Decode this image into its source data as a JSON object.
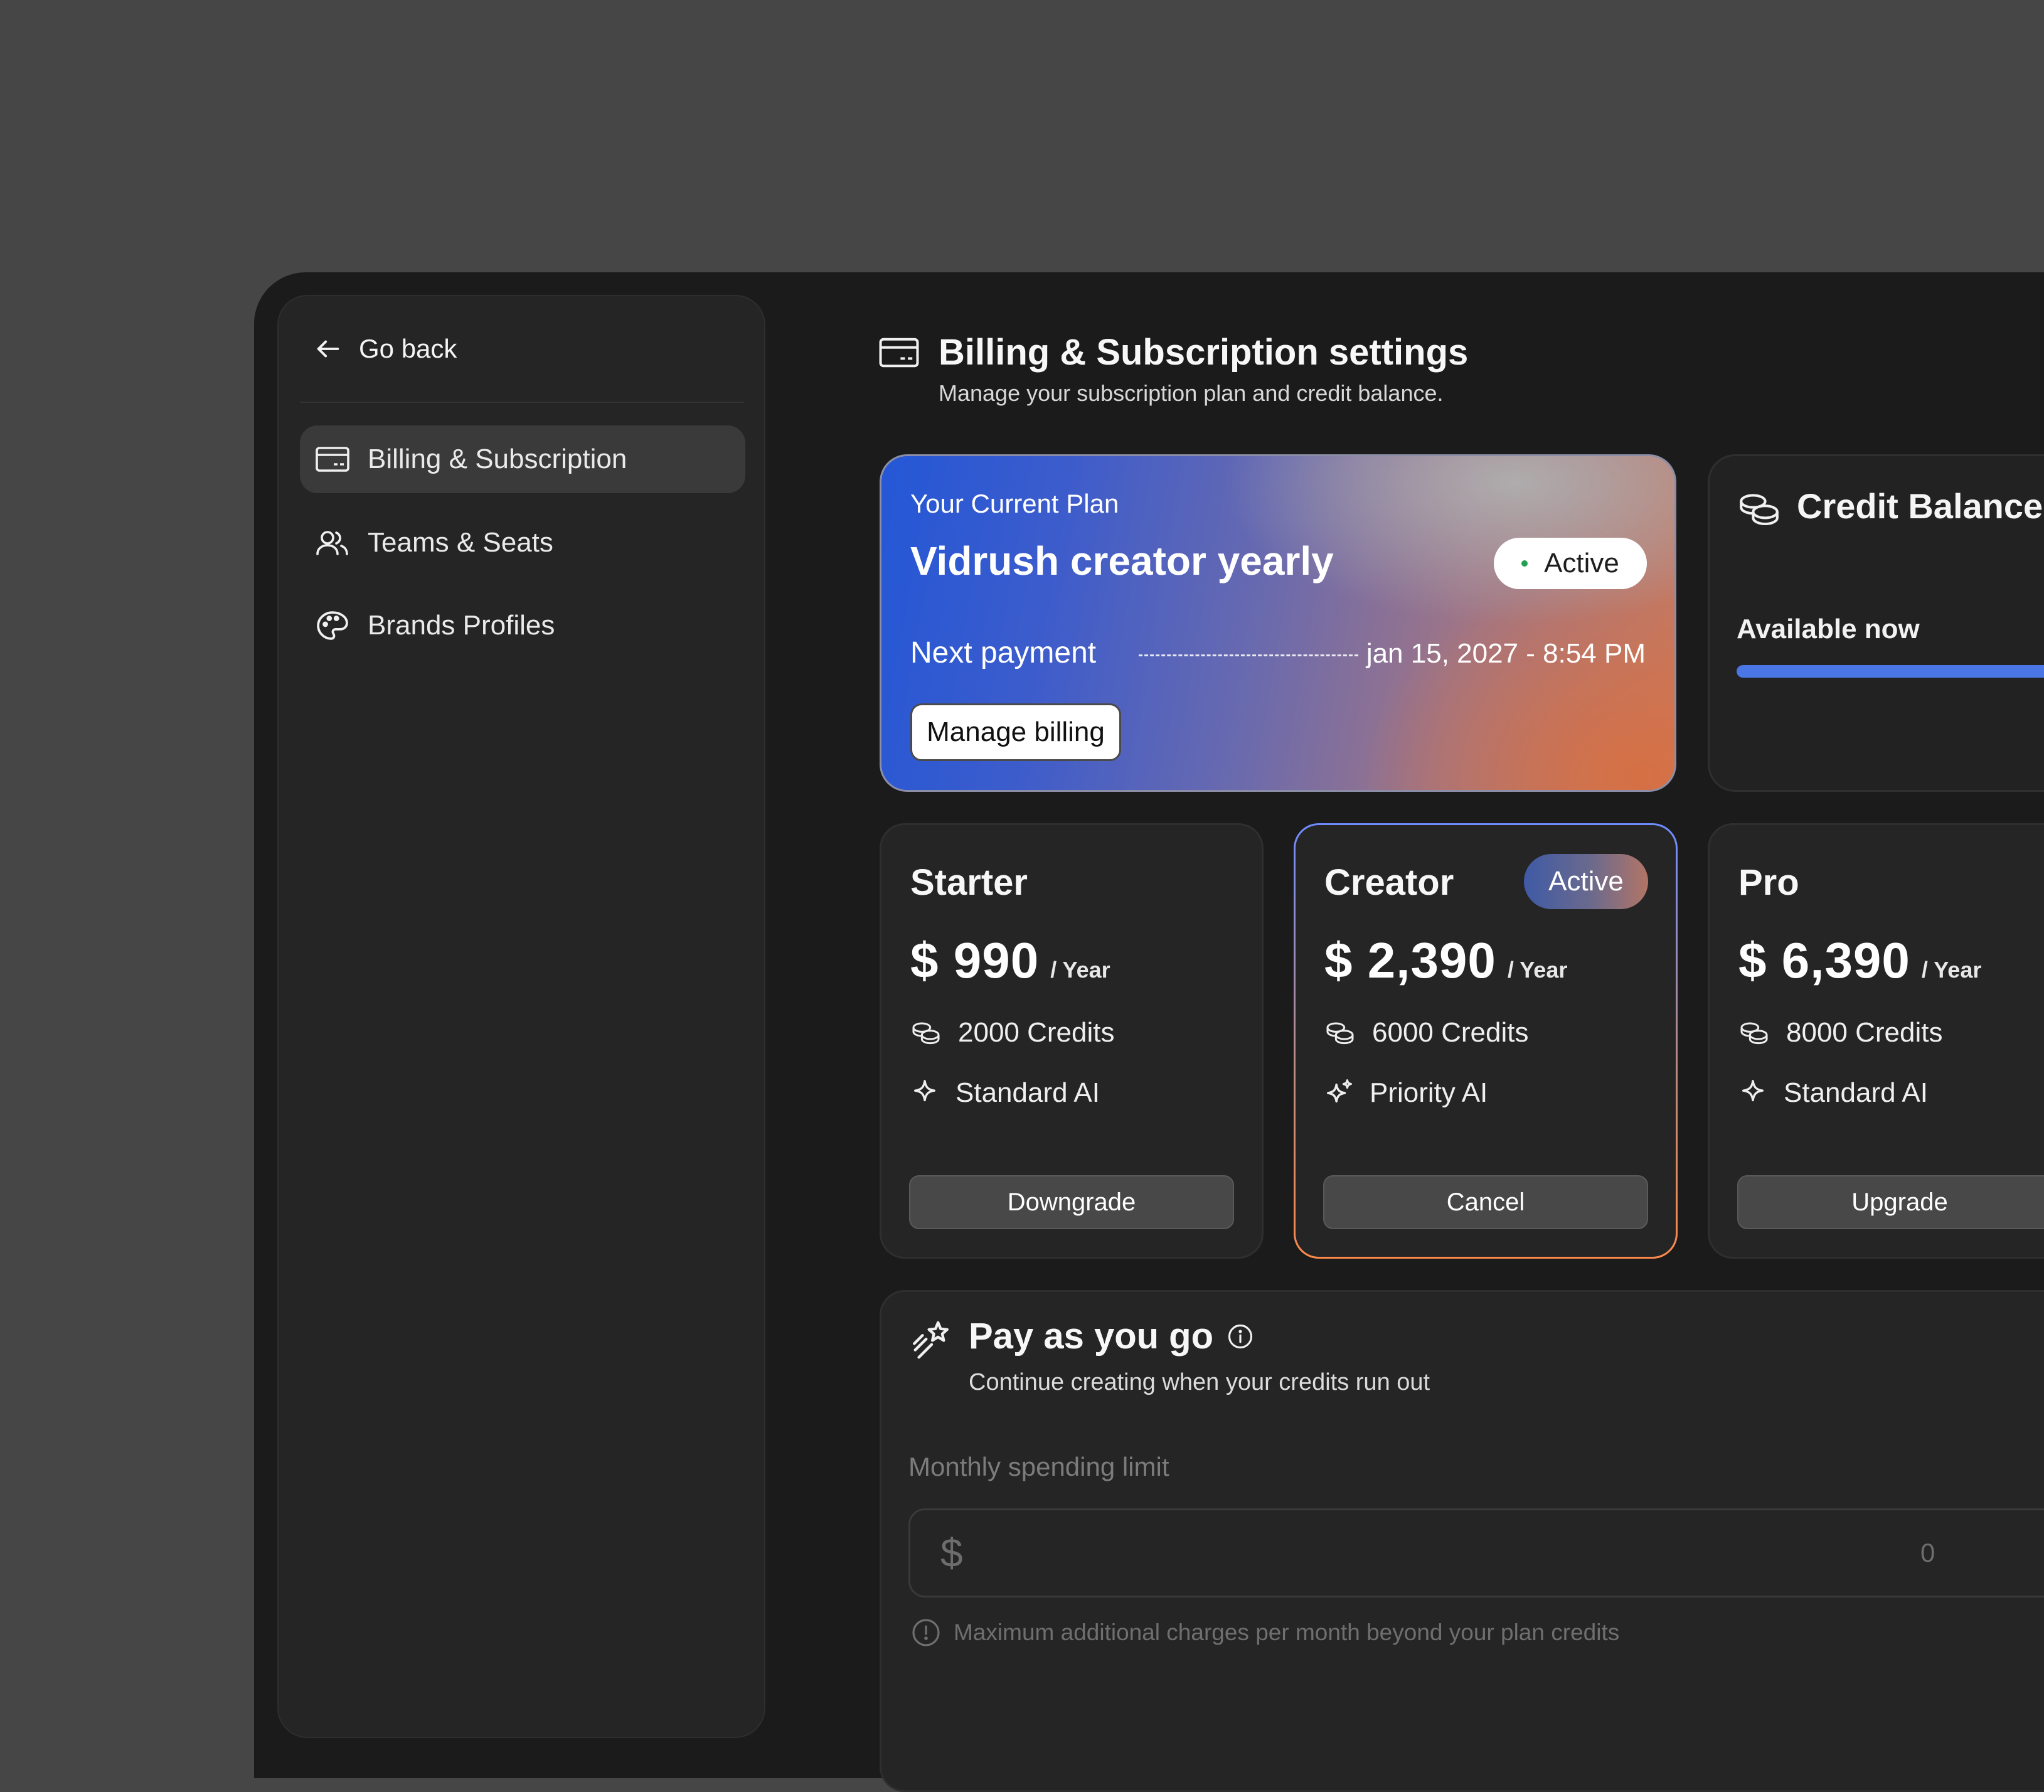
{
  "sidebar": {
    "back_label": "Go back",
    "items": [
      {
        "label": "Billing & Subscription",
        "icon": "credit-card-icon",
        "active": true
      },
      {
        "label": "Teams & Seats",
        "icon": "users-icon",
        "active": false
      },
      {
        "label": "Brands Profiles",
        "icon": "palette-icon",
        "active": false
      }
    ]
  },
  "header": {
    "icon": "credit-card-icon",
    "title": "Billing & Subscription settings",
    "subtitle": "Manage your subscription plan and credit balance."
  },
  "current_plan": {
    "label": "Your Current Plan",
    "name": "Vidrush creator yearly",
    "status": "Active",
    "next_payment_label": "Next payment",
    "next_payment_date": "jan 15, 2027 - 8:54 PM",
    "manage_button": "Manage billing"
  },
  "credit_balance": {
    "icon": "coins-icon",
    "title": "Credit Balance",
    "available_label": "Available now"
  },
  "tiers": [
    {
      "name": "Starter",
      "price": "$ 990",
      "period": "/ Year",
      "credits": "2000 Credits",
      "ai": "Standard AI",
      "ai_icon": "sparkle-icon",
      "button": "Downgrade",
      "badge": ""
    },
    {
      "name": "Creator",
      "price": "$ 2,390",
      "period": "/ Year",
      "credits": "6000 Credits",
      "ai": "Priority AI",
      "ai_icon": "sparkles-icon",
      "button": "Cancel",
      "badge": "Active"
    },
    {
      "name": "Pro",
      "price": "$ 6,390",
      "period": "/ Year",
      "credits": "8000 Credits",
      "ai": "Standard AI",
      "ai_icon": "sparkle-icon",
      "button": "Upgrade",
      "badge": ""
    }
  ],
  "payg": {
    "icon": "shooting-star-icon",
    "title": "Pay as you go",
    "subtitle": "Continue creating when your credits run out",
    "limit_label": "Monthly spending limit",
    "currency": "$",
    "limit_value": "0",
    "hint": "Maximum additional charges per month beyond your plan credits"
  },
  "colors": {
    "accent_blue": "#4a76e6",
    "active_dot": "#22a050",
    "background": "#464646",
    "app_bg": "#1b1b1b"
  }
}
